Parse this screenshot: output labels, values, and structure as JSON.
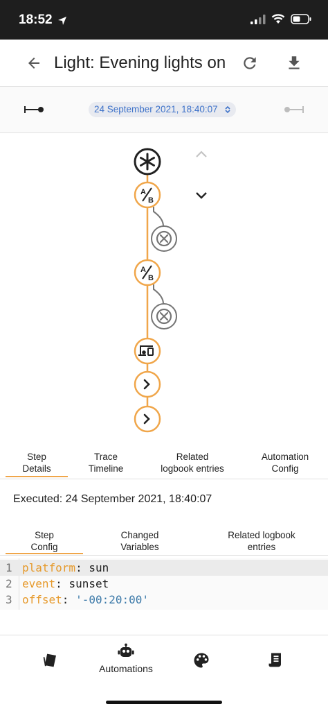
{
  "status_bar": {
    "time": "18:52"
  },
  "header": {
    "title": "Light: Evening lights on"
  },
  "trace_nav": {
    "timestamp": "24 September 2021, 18:40:07"
  },
  "graph": {
    "nodes": [
      {
        "name": "trigger-node",
        "icon": "asterisk-icon",
        "style": "dark"
      },
      {
        "name": "condition-node",
        "icon": "ab-icon",
        "style": "active"
      },
      {
        "name": "condition-branch-node",
        "icon": "close-icon",
        "style": "inactive"
      },
      {
        "name": "condition-node",
        "icon": "ab-icon",
        "style": "active"
      },
      {
        "name": "condition-branch-node",
        "icon": "close-icon",
        "style": "inactive"
      },
      {
        "name": "device-action-node",
        "icon": "devices-icon",
        "style": "active"
      },
      {
        "name": "action-node",
        "icon": "chevron-right-icon",
        "style": "active"
      },
      {
        "name": "action-node",
        "icon": "chevron-right-icon",
        "style": "active"
      }
    ],
    "active_color": "#f0a64a",
    "inactive_color": "#757575"
  },
  "tabs": [
    {
      "label_1": "Step",
      "label_2": "Details",
      "selected": true
    },
    {
      "label_1": "Trace",
      "label_2": "Timeline",
      "selected": false
    },
    {
      "label_1": "Related",
      "label_2": "logbook entries",
      "selected": false
    },
    {
      "label_1": "Automation",
      "label_2": "Config",
      "selected": false
    }
  ],
  "executed": "Executed: 24 September 2021, 18:40:07",
  "subtabs": [
    {
      "label_1": "Step",
      "label_2": "Config",
      "selected": true
    },
    {
      "label_1": "Changed",
      "label_2": "Variables",
      "selected": false
    },
    {
      "label_1": "Related logbook",
      "label_2": "entries",
      "selected": false
    }
  ],
  "code": {
    "lines": [
      {
        "num": "1",
        "key": "platform",
        "sep": ": ",
        "value": "sun",
        "string": ""
      },
      {
        "num": "2",
        "key": "event",
        "sep": ": ",
        "value": "sunset",
        "string": ""
      },
      {
        "num": "3",
        "key": "offset",
        "sep": ": ",
        "value": "",
        "string": "'-00:20:00'"
      }
    ]
  },
  "bottom_nav": {
    "automations_label": "Automations"
  },
  "colors": {
    "accent": "#f0a64a",
    "link": "#3f73c9",
    "status_bar": "#1e1e1e"
  }
}
